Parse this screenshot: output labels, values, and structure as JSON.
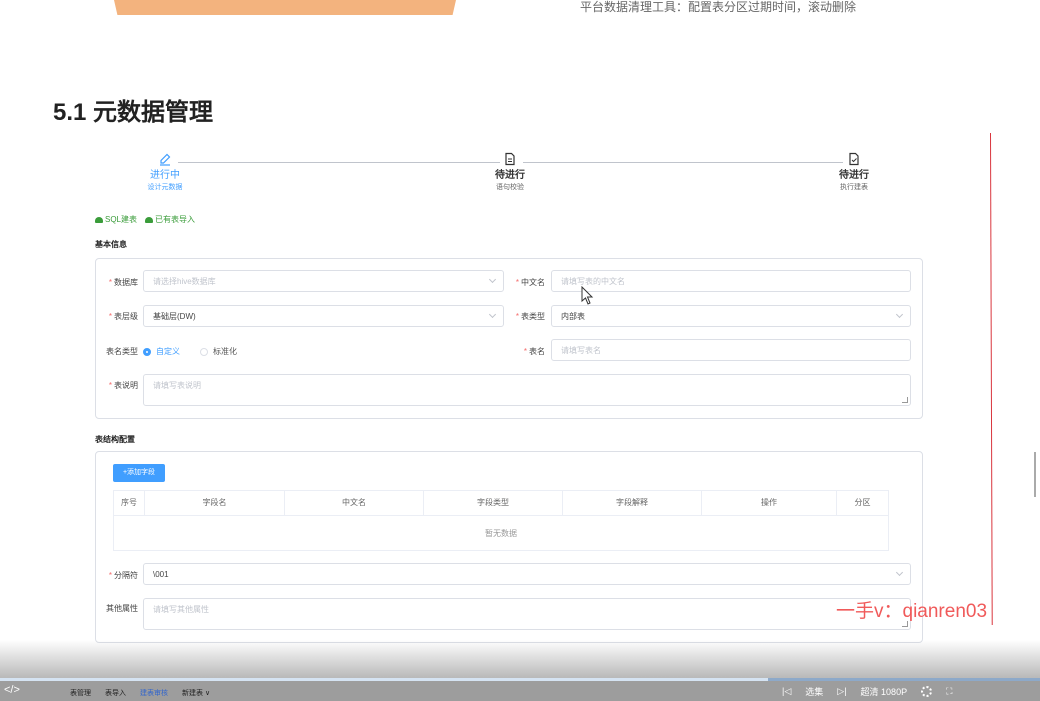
{
  "top_caption": "平台数据清理工具：配置表分区过期时间，滚动删除",
  "section_title": "5.1 元数据管理",
  "steps": [
    {
      "title": "进行中",
      "desc": "设计元数据",
      "status": "active",
      "icon": "edit-icon"
    },
    {
      "title": "待进行",
      "desc": "语句校验",
      "status": "wait",
      "icon": "document-icon"
    },
    {
      "title": "待进行",
      "desc": "执行建表",
      "status": "wait",
      "icon": "document-check-icon"
    }
  ],
  "import_links": [
    "SQL建表",
    "已有表导入"
  ],
  "basic_info": {
    "heading": "基本信息",
    "database_label": "数据库",
    "database_placeholder": "请选择hive数据库",
    "cn_name_label": "中文名",
    "cn_name_placeholder": "请填写表的中文名",
    "layer_label": "表层级",
    "layer_value": "基础层(DW)",
    "table_type_label": "表类型",
    "table_type_value": "内部表",
    "name_type_label": "表名类型",
    "name_type_options": [
      "自定义",
      "标准化"
    ],
    "name_type_selected": "自定义",
    "table_name_label": "表名",
    "table_name_placeholder": "请填写表名",
    "desc_label": "表说明",
    "desc_placeholder": "请填写表说明"
  },
  "structure": {
    "heading": "表结构配置",
    "add_field_button": "+添加字段",
    "columns": [
      "序号",
      "字段名",
      "中文名",
      "字段类型",
      "字段解释",
      "操作",
      "分区"
    ],
    "empty_text": "暂无数据",
    "delimiter_label": "分隔符",
    "delimiter_value": "\\001",
    "other_props_label": "其他属性",
    "other_props_placeholder": "请填写其他属性"
  },
  "watermark": "一手v：qianren03",
  "player": {
    "code_icon": "</>",
    "tabs": [
      "表管理",
      "表导入",
      "建表审核",
      "新建表 ∨"
    ],
    "active_tab": "建表审核",
    "episodes": "选集",
    "quality": "超清 1080P",
    "progress": 0.738,
    "colors": {
      "accent": "#409eff",
      "success": "#3a9c3a",
      "required": "#f56c6c"
    }
  }
}
